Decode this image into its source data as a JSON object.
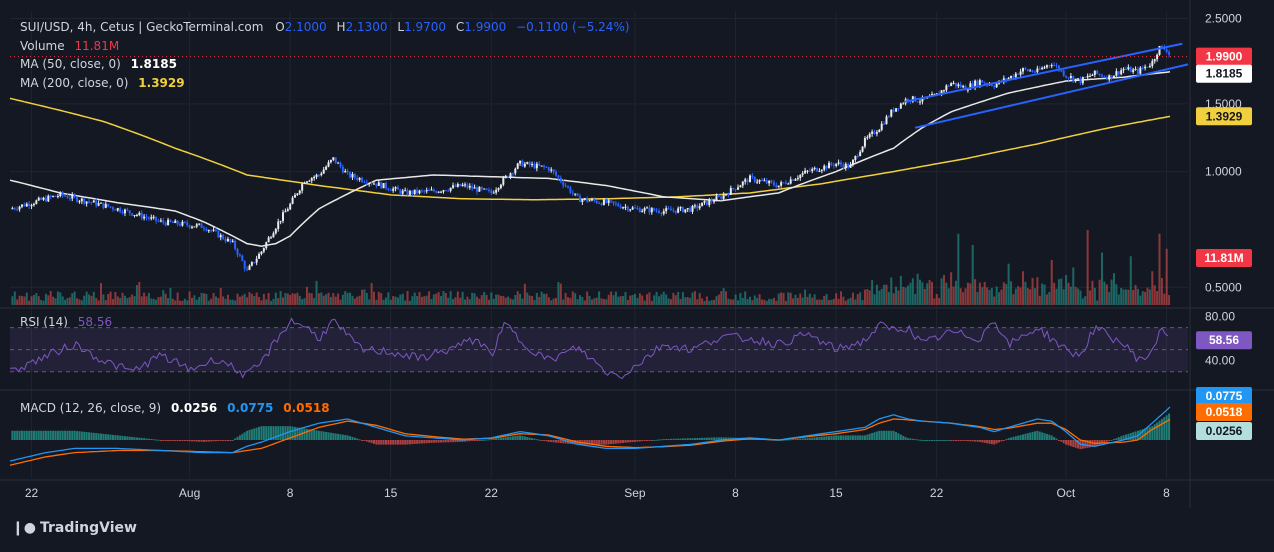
{
  "header": {
    "symbol": "SUI/USD, 4h, Cetus | GeckoTerminal.com",
    "ohlc": [
      {
        "k": "O",
        "v": "2.1000"
      },
      {
        "k": "H",
        "v": "2.1300"
      },
      {
        "k": "L",
        "v": "1.9700"
      },
      {
        "k": "C",
        "v": "1.9900"
      }
    ],
    "change": "−0.1100 (−5.24%)",
    "volume_label": "Volume",
    "volume_value": "11.81M",
    "ma50_label": "MA (50, close, 0)",
    "ma50_value": "1.8185",
    "ma200_label": "MA (200, close, 0)",
    "ma200_value": "1.3929",
    "rsi_label": "RSI (14)",
    "rsi_value": "58.56",
    "macd_label": "MACD (12, 26, close, 9)",
    "macd_values": [
      "0.0256",
      "0.0775",
      "0.0518"
    ]
  },
  "colors": {
    "background": "#141822",
    "grid": "#1f2431",
    "candle_up": "#e8ebf0",
    "candle_down": "#2962ff",
    "ma50": "#e8e8e8",
    "ma200": "#f2d03d",
    "channel": "#2962ff",
    "vol_up": "#26a69a",
    "vol_down": "#ef5350",
    "rsi": "#7e57c2",
    "macd": "#2196f3",
    "signal": "#ff6d00",
    "price_tag": "#f23645"
  },
  "chart_data": [
    {
      "type": "candlestick",
      "pair": "SUI/USD",
      "timeframe": "4h",
      "yticks": [
        "2.5000",
        "1.5000",
        "1.0000",
        "0.5000"
      ],
      "ylim": [
        0.45,
        2.6
      ],
      "x_labels": [
        "22",
        "Aug",
        "8",
        "15",
        "22",
        "Sep",
        "8",
        "15",
        "22",
        "Oct",
        "8"
      ],
      "x_days": [
        -10,
        1,
        8,
        15,
        22,
        32,
        39,
        46,
        53,
        62,
        69
      ],
      "x_range": [
        -11.5,
        70.5
      ],
      "close_path_days": [
        -11.5,
        -8,
        -4,
        -1,
        2,
        4,
        5,
        6,
        7,
        8,
        9,
        10,
        11,
        12,
        14,
        16,
        18,
        20,
        22,
        24,
        26,
        28,
        30,
        32,
        34,
        36,
        38,
        40,
        42,
        44,
        46,
        47,
        48,
        49,
        50,
        51,
        52,
        53,
        54,
        55,
        56,
        57,
        58,
        59,
        60,
        61,
        62,
        63,
        64,
        65,
        66,
        67,
        68,
        68.5,
        69,
        69.3
      ],
      "close_path_values": [
        0.8,
        0.87,
        0.8,
        0.74,
        0.72,
        0.65,
        0.55,
        0.62,
        0.72,
        0.82,
        0.95,
        0.98,
        1.08,
        0.98,
        0.93,
        0.88,
        0.89,
        0.92,
        0.88,
        1.05,
        1.02,
        0.85,
        0.83,
        0.8,
        0.79,
        0.8,
        0.86,
        0.96,
        0.92,
        1.0,
        1.05,
        1.03,
        1.2,
        1.3,
        1.45,
        1.55,
        1.53,
        1.58,
        1.7,
        1.65,
        1.72,
        1.68,
        1.75,
        1.84,
        1.82,
        1.92,
        1.78,
        1.72,
        1.8,
        1.76,
        1.85,
        1.82,
        1.92,
        2.1,
        2.08,
        1.99
      ],
      "ma50_days": [
        -11.5,
        -8,
        -4,
        0,
        2,
        4,
        5,
        6,
        7,
        8,
        10,
        14,
        18,
        22,
        26,
        30,
        34,
        38,
        42,
        46,
        50,
        52,
        54,
        58,
        62,
        66,
        69.3
      ],
      "ma50_values": [
        0.95,
        0.88,
        0.83,
        0.79,
        0.74,
        0.68,
        0.65,
        0.64,
        0.65,
        0.68,
        0.8,
        0.95,
        0.98,
        0.97,
        0.96,
        0.92,
        0.86,
        0.84,
        0.88,
        1.0,
        1.15,
        1.3,
        1.43,
        1.6,
        1.72,
        1.76,
        1.8185
      ],
      "ma200_days": [
        -11.5,
        -5,
        0,
        5,
        10,
        15,
        20,
        25,
        30,
        35,
        40,
        45,
        50,
        55,
        60,
        65,
        69.3
      ],
      "ma200_values": [
        1.55,
        1.35,
        1.15,
        0.98,
        0.92,
        0.87,
        0.85,
        0.845,
        0.85,
        0.86,
        0.88,
        0.93,
        1.0,
        1.08,
        1.18,
        1.3,
        1.3929
      ],
      "channel_upper": [
        [
          50.8,
          1.52
        ],
        [
          70.1,
          2.15
        ]
      ],
      "channel_lower": [
        [
          51.5,
          1.3
        ],
        [
          70.5,
          1.9
        ]
      ],
      "last_price": "1.9900",
      "ma50_last": "1.8185",
      "ma200_last": "1.3929"
    },
    {
      "type": "bar",
      "name": "Volume",
      "last_value": "11.81M",
      "spike_days": [
        53.5,
        54.5,
        55.5,
        58.0,
        59.0,
        61.0,
        62.5,
        63.5,
        64.5,
        66.5,
        68.0,
        68.5,
        69.0
      ],
      "spike_values": [
        0.4,
        0.95,
        0.8,
        0.55,
        0.45,
        0.6,
        0.5,
        1.0,
        0.7,
        0.65,
        0.45,
        0.95,
        0.75
      ]
    },
    {
      "type": "line",
      "name": "RSI (14)",
      "yticks": [
        "80.00",
        "40.00"
      ],
      "ylim": [
        18,
        85
      ],
      "bands": [
        70,
        30
      ],
      "days": [
        -11.5,
        -9,
        -7,
        -5,
        -3,
        -1,
        1,
        3,
        5,
        6,
        7,
        8,
        9,
        10,
        11,
        12,
        13,
        15,
        17,
        19,
        21,
        22,
        23,
        24,
        26,
        28,
        30,
        31,
        32,
        34,
        36,
        38,
        40,
        42,
        44,
        46,
        48,
        49,
        50,
        51,
        52,
        54,
        56,
        57,
        58,
        60,
        62,
        63,
        64,
        66,
        67,
        68,
        68.6,
        69.3
      ],
      "values": [
        30,
        44,
        55,
        40,
        30,
        45,
        32,
        42,
        26,
        38,
        58,
        76,
        72,
        60,
        76,
        62,
        50,
        48,
        42,
        50,
        60,
        45,
        74,
        58,
        40,
        52,
        30,
        26,
        35,
        55,
        50,
        62,
        60,
        55,
        64,
        50,
        58,
        72,
        68,
        70,
        55,
        66,
        60,
        78,
        54,
        70,
        50,
        44,
        70,
        55,
        42,
        45,
        72,
        58.56
      ],
      "last_value": "58.56"
    },
    {
      "type": "line",
      "name": "MACD (12, 26, close, 9)",
      "macd_last": "0.0256",
      "signal_last": "0.0775",
      "hist_last": "0.0518",
      "days": [
        -11.5,
        -9,
        -7,
        -4,
        -1,
        2,
        4,
        5,
        6,
        8,
        10,
        12,
        14,
        16,
        18,
        20,
        22,
        24,
        26,
        28,
        30,
        32,
        34,
        36,
        38,
        40,
        42,
        44,
        46,
        48,
        49,
        50,
        51,
        52,
        54,
        56,
        57,
        58,
        60,
        61,
        62,
        63,
        64,
        66,
        67,
        68,
        69.3
      ],
      "macd_values": [
        -0.05,
        -0.03,
        -0.02,
        -0.02,
        -0.025,
        -0.03,
        -0.03,
        -0.015,
        -0.005,
        0.02,
        0.04,
        0.05,
        0.03,
        0.01,
        0.005,
        0.0,
        0.005,
        0.02,
        0.01,
        -0.01,
        -0.02,
        -0.02,
        -0.015,
        -0.01,
        0.0,
        0.005,
        0.0,
        0.01,
        0.02,
        0.03,
        0.05,
        0.06,
        0.05,
        0.045,
        0.04,
        0.03,
        0.02,
        0.03,
        0.05,
        0.045,
        0.02,
        -0.01,
        -0.015,
        0.0,
        0.01,
        0.04,
        0.08
      ],
      "signal_values": [
        -0.06,
        -0.04,
        -0.03,
        -0.025,
        -0.025,
        -0.028,
        -0.03,
        -0.025,
        -0.02,
        0.005,
        0.03,
        0.045,
        0.035,
        0.015,
        0.008,
        0.002,
        0.004,
        0.015,
        0.012,
        -0.005,
        -0.015,
        -0.018,
        -0.016,
        -0.012,
        -0.003,
        0.003,
        0.0,
        0.008,
        0.015,
        0.025,
        0.04,
        0.05,
        0.048,
        0.045,
        0.04,
        0.032,
        0.025,
        0.028,
        0.04,
        0.04,
        0.025,
        0.0,
        -0.008,
        -0.005,
        0.0,
        0.025,
        0.05
      ],
      "last_labels": [
        "0.0775",
        "0.0518",
        "0.0256"
      ]
    }
  ],
  "footer": {
    "brand": "TradingView"
  }
}
